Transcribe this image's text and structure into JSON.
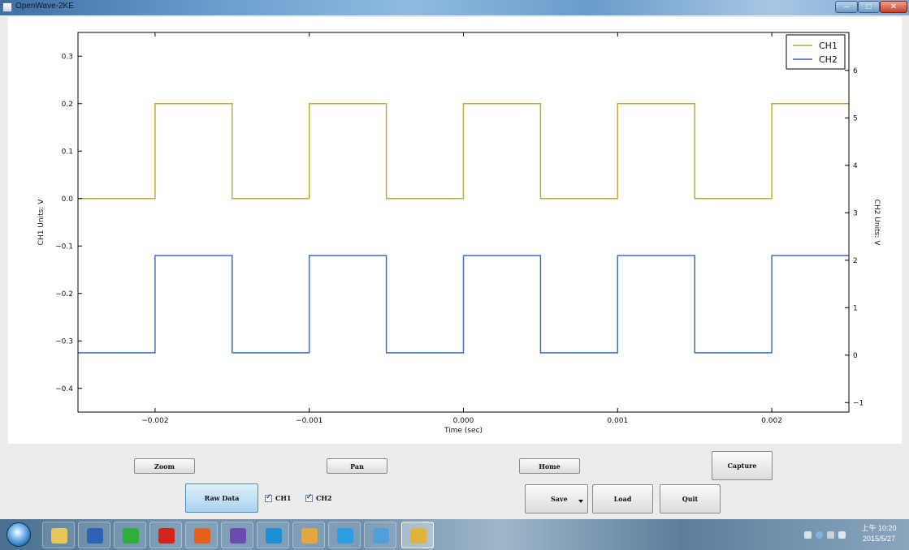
{
  "window": {
    "title": "OpenWave-2KE",
    "controls": {
      "minimize": "–",
      "maximize": "□",
      "close": "✕"
    }
  },
  "toolbar": {
    "zoom_label": "Zoom",
    "pan_label": "Pan",
    "home_label": "Home",
    "capture_label": "Capture",
    "raw_data_label": "Raw Data",
    "save_label": "Save",
    "load_label": "Load",
    "quit_label": "Quit",
    "ch1_checkbox": {
      "label": "CH1",
      "checked": true
    },
    "ch2_checkbox": {
      "label": "CH2",
      "checked": true
    }
  },
  "chart_data": {
    "type": "line",
    "title": "",
    "xlabel": "Time (sec)",
    "ylabel_left": "CH1 Units: V",
    "ylabel_right": "CH2 Units: V",
    "xlim": [
      -0.0025,
      0.0025
    ],
    "ylim_left": [
      -0.45,
      0.35
    ],
    "ylim_right": [
      -1.2,
      6.8
    ],
    "x_ticks": [
      -0.002,
      -0.001,
      0.0,
      0.001,
      0.002
    ],
    "x_tick_labels": [
      "−0.002",
      "−0.001",
      "0.000",
      "0.001",
      "0.002"
    ],
    "y_left_ticks": [
      -0.4,
      -0.3,
      -0.2,
      -0.1,
      0.0,
      0.1,
      0.2,
      0.3
    ],
    "y_left_tick_labels": [
      "−0.4",
      "−0.3",
      "−0.2",
      "−0.1",
      "0.0",
      "0.1",
      "0.2",
      "0.3"
    ],
    "y_right_ticks": [
      -1,
      0,
      1,
      2,
      3,
      4,
      5,
      6
    ],
    "y_right_tick_labels": [
      "−1",
      "0",
      "1",
      "2",
      "3",
      "4",
      "5",
      "6"
    ],
    "legend_position": "top-right",
    "grid": false,
    "series": [
      {
        "name": "CH1",
        "axis": "left",
        "color": "#c0a83c",
        "x": [
          -0.0025,
          -0.002,
          -0.002,
          -0.0015,
          -0.0015,
          -0.001,
          -0.001,
          -0.0005,
          -0.0005,
          0.0,
          0.0,
          0.0005,
          0.0005,
          0.001,
          0.001,
          0.0015,
          0.0015,
          0.002,
          0.002,
          0.0025
        ],
        "y": [
          0.0,
          0.0,
          0.2,
          0.2,
          0.0,
          0.0,
          0.2,
          0.2,
          0.0,
          0.0,
          0.2,
          0.2,
          0.0,
          0.0,
          0.2,
          0.2,
          0.0,
          0.0,
          0.2,
          0.2
        ]
      },
      {
        "name": "CH2",
        "axis": "right",
        "color": "#3a6fc4",
        "x": [
          -0.0025,
          -0.002,
          -0.002,
          -0.0015,
          -0.0015,
          -0.001,
          -0.001,
          -0.0005,
          -0.0005,
          0.0,
          0.0,
          0.0005,
          0.0005,
          0.001,
          0.001,
          0.0015,
          0.0015,
          0.002,
          0.002,
          0.0025
        ],
        "y": [
          0.05,
          0.05,
          2.1,
          2.1,
          0.05,
          0.05,
          2.1,
          2.1,
          0.05,
          0.05,
          2.1,
          2.1,
          0.05,
          0.05,
          2.1,
          2.1,
          0.05,
          0.05,
          2.1,
          2.1
        ]
      }
    ]
  },
  "taskbar": {
    "items": [
      {
        "name": "file-explorer",
        "icon": "folder-icon",
        "color": "#e8c65a"
      },
      {
        "name": "word",
        "icon": "word-icon",
        "color": "#2f62b4"
      },
      {
        "name": "wechat",
        "icon": "wechat-icon",
        "color": "#2fae3a"
      },
      {
        "name": "opera",
        "icon": "opera-icon",
        "color": "#d5221b"
      },
      {
        "name": "media-player",
        "icon": "media-player-icon",
        "color": "#e4611a"
      },
      {
        "name": "messenger",
        "icon": "messenger-icon",
        "color": "#6a4bb0"
      },
      {
        "name": "skype",
        "icon": "skype-icon",
        "color": "#1d8fd6"
      },
      {
        "name": "graduation",
        "icon": "graduation-icon",
        "color": "#e2a83d"
      },
      {
        "name": "internet-explorer",
        "icon": "internet-explorer-icon",
        "color": "#2c9ee3"
      },
      {
        "name": "photo-viewer",
        "icon": "photo-viewer-icon",
        "color": "#4fa0d8"
      },
      {
        "name": "openwave",
        "icon": "openwave-icon",
        "color": "#e0b43a",
        "active": true
      }
    ],
    "clock_time": "上午 10:20",
    "clock_date": "2015/5/27"
  }
}
